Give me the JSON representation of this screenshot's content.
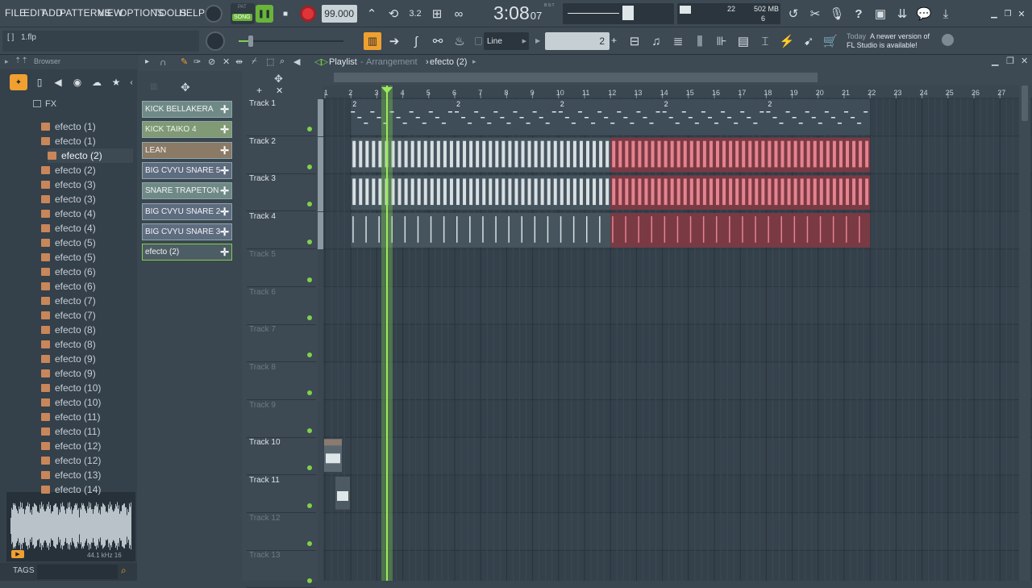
{
  "menu": [
    "FILE",
    "EDIT",
    "ADD",
    "PATTERNS",
    "VIEW",
    "OPTIONS",
    "TOOLS",
    "HELP"
  ],
  "transport": {
    "pat_label": "PAT",
    "song_label": "SONG",
    "tempo": "99.000",
    "time_main": "3:08",
    "time_sub": "07",
    "time_unit": "B:S:T",
    "cpu_value": "22",
    "memory": "502 MB",
    "poly": "6"
  },
  "hint": {
    "file": "1.flp"
  },
  "snap": {
    "mode": "Line",
    "pattern_num": "2"
  },
  "news": {
    "today": "Today",
    "message_line1": "A newer version of",
    "message_line2": "FL Studio is available!"
  },
  "browser": {
    "title": "Browser",
    "folder": "FX",
    "items": [
      "efecto (1)",
      "efecto (1)",
      "efecto (2)",
      "efecto (2)",
      "efecto (3)",
      "efecto (3)",
      "efecto (4)",
      "efecto (4)",
      "efecto (5)",
      "efecto (5)",
      "efecto (6)",
      "efecto (6)",
      "efecto (7)",
      "efecto (7)",
      "efecto (8)",
      "efecto (8)",
      "efecto (9)",
      "efecto (9)",
      "efecto (10)",
      "efecto (10)",
      "efecto (11)",
      "efecto (11)",
      "efecto (12)",
      "efecto (12)",
      "efecto (13)",
      "efecto (14)"
    ],
    "selected_index": 2,
    "sample_rate": "44.1 kHz 16",
    "tags_label": "TAGS"
  },
  "playlist": {
    "title": "Playlist",
    "subtitle": "Arrangement",
    "pattern": "efecto (2)",
    "bars": [
      "1",
      "2",
      "3",
      "4",
      "5",
      "6",
      "7",
      "8",
      "9",
      "10",
      "11",
      "12",
      "13",
      "14",
      "15",
      "16",
      "17",
      "18",
      "19",
      "20",
      "21",
      "22",
      "23",
      "24",
      "25",
      "26",
      "27"
    ],
    "tracks": [
      "Track 1",
      "Track 2",
      "Track 3",
      "Track 4",
      "Track 5",
      "Track 6",
      "Track 7",
      "Track 8",
      "Track 9",
      "Track 10",
      "Track 11",
      "Track 12",
      "Track 13"
    ],
    "pattern_label": "2"
  },
  "channels": [
    {
      "name": "KICK BELLAKERA",
      "color": "#6f8a86"
    },
    {
      "name": "KICK TAIKO 4",
      "color": "#7f9a74"
    },
    {
      "name": "LEAN",
      "color": "#8a7a66"
    },
    {
      "name": "BIG CVYU SNARE 5",
      "color": "#5e6c80"
    },
    {
      "name": "SNARE TRAPETON",
      "color": "#6f8a86"
    },
    {
      "name": "BIG CVYU SNARE 2",
      "color": "#5e6c80"
    },
    {
      "name": "BIG CVYU SNARE 3",
      "color": "#5e6c80"
    },
    {
      "name": "efecto (2)",
      "color": "#4d5d66"
    }
  ]
}
